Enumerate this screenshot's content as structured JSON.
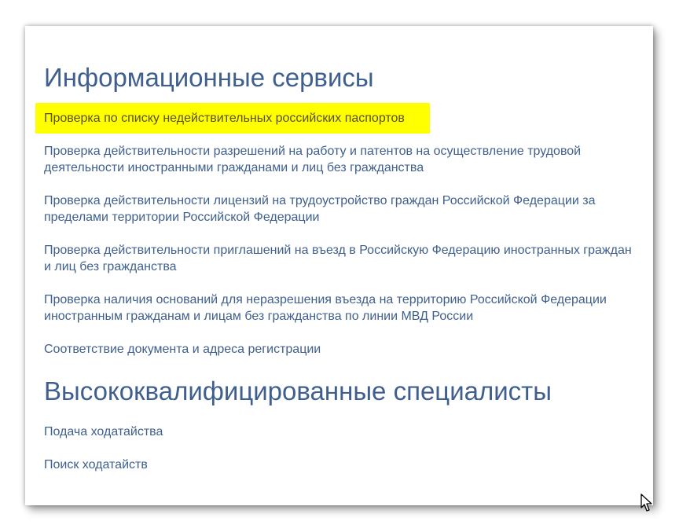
{
  "sections": [
    {
      "title": "Информационные сервисы",
      "links": [
        {
          "label": "Проверка по списку недействительных российских паспортов"
        },
        {
          "label": "Проверка действительности разрешений на работу и патентов на осуществление трудовой деятельности иностранными гражданами и лиц без гражданства"
        },
        {
          "label": "Проверка действительности лицензий на трудоустройство граждан Российской Федерации за пределами территории Российской Федерации"
        },
        {
          "label": "Проверка действительности приглашений на въезд в Российскую Федерацию иностранных граждан и лиц без гражданства"
        },
        {
          "label": "Проверка наличия оснований для неразрешения въезда на территорию Российской Федерации иностранным гражданам и лицам без гражданства по линии МВД России"
        },
        {
          "label": "Соответствие документа и адреса регистрации"
        }
      ]
    },
    {
      "title": "Высококвалифицированные специалисты",
      "links": [
        {
          "label": "Подача ходатайства"
        },
        {
          "label": "Поиск ходатайств"
        }
      ]
    }
  ],
  "colors": {
    "link": "#3f5f8e",
    "highlight": "#ffff00",
    "highlight_text": "#5a4e1a"
  },
  "icons": {
    "cursor": "mouse-pointer-icon"
  }
}
